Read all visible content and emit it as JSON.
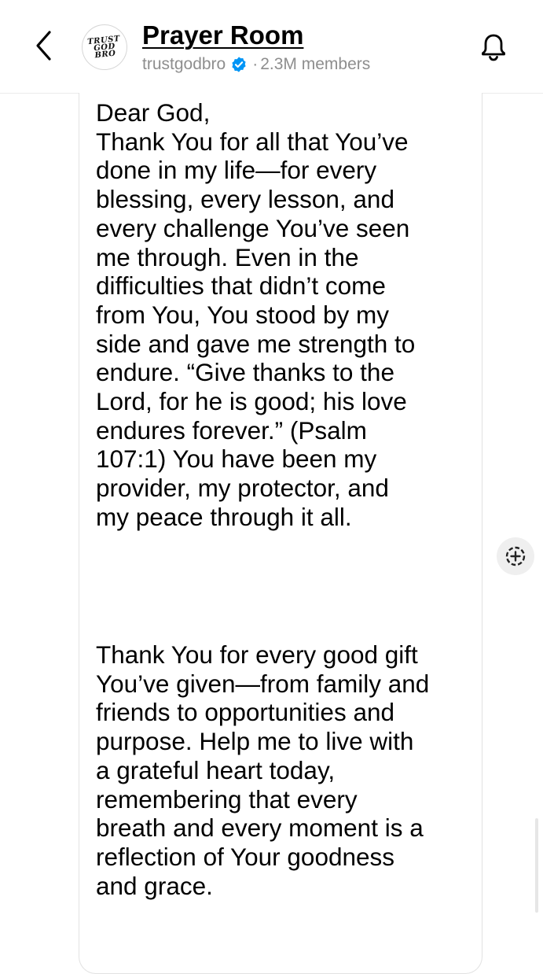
{
  "header": {
    "back_icon": "chevron-left-icon",
    "avatar_lines": [
      "TRUST",
      "GOD",
      "BRO"
    ],
    "title": "Prayer Room",
    "username": "trustgodbro",
    "verified_icon": "verified-badge-icon",
    "separator": "·",
    "members": "2.3M members",
    "bell_icon": "bell-icon"
  },
  "message": {
    "paragraph_1": "Dear God,\nThank You for all that You’ve\ndone in my life—for every\nblessing, every lesson, and\nevery challenge You’ve seen\nme through. Even in the\ndifficulties that didn’t come\nfrom You, You stood by my\nside and gave me strength to\nendure. “Give thanks to the\nLord, for he is good; his love\nendures forever.” (Psalm\n107:1) You have been my\nprovider, my protector, and\nmy peace through it all.",
    "paragraph_2": "Thank You for every good gift\nYou’ve given—from family and\nfriends to opportunities and\npurpose. Help me to live with\na grateful heart today,\nremembering that every\nbreath and every moment is a\nreflection of Your goodness\nand grace."
  },
  "actions": {
    "react_icon": "add-reaction-icon"
  },
  "colors": {
    "text": "#000000",
    "muted": "#8e8e8e",
    "verified": "#0095f6",
    "border": "#e2e2e2",
    "button_bg": "#efefef"
  }
}
